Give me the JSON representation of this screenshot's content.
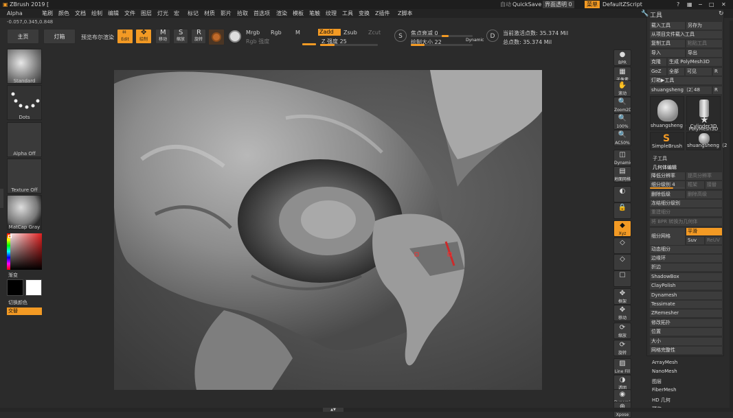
{
  "app": {
    "title": "ZBrush 2019 [",
    "autosave_label": "自动",
    "quicksave": "QuickSave",
    "ui_transparency": "界面透明 0",
    "menu_button": "菜单",
    "script": "DefaultZScript"
  },
  "menu": [
    "Alpha",
    "笔刷",
    "颜色",
    "文档",
    "绘制",
    "编辑",
    "文件",
    "图层",
    "灯光",
    "宏",
    "标记",
    "材质",
    "影片",
    "拾取",
    "首选项",
    "渲染",
    "模板",
    "笔触",
    "纹理",
    "工具",
    "变换",
    "Z插件",
    "Z脚本"
  ],
  "coords": "-0.057,0.345,0.848",
  "top": {
    "home": "主页",
    "lightbox": "灯箱",
    "preview_bpr": "预览布尔渲染",
    "edit": "Edit",
    "draw": "绘制",
    "move": "移动",
    "scale": "缩放",
    "rotate": "旋转",
    "mrgb": "Mrgb",
    "rgb": "Rgb",
    "m": "M",
    "zadd": "Zadd",
    "zsub": "Zsub",
    "zcut": "Zcut",
    "rgb_intensity": "Rgb 强度",
    "z_intensity": "Z 强度 25",
    "z_intensity_value": 25,
    "focal": "焦点衰减 0",
    "focal_value": 0,
    "draw_size": "绘制大小 22",
    "draw_size_value": 22,
    "dynamic": "Dynamic",
    "active_points": "当前激活点数: 35.374 Mil",
    "total_points": "总点数: 35.374 Mil"
  },
  "left": {
    "brush": "Standard",
    "stroke": "Dots",
    "alpha": "Alpha Off",
    "texture": "Texture Off",
    "material": "MatCap Gray",
    "gradient": "渐变",
    "switch_color": "切换颜色",
    "alternate": "交替"
  },
  "right_shelf": [
    "BPR",
    "子像素",
    "滚动",
    "Zoom2D",
    "100%",
    "AC50%",
    "Dynamic 透视",
    "地面网格",
    "",
    "",
    "Xyz",
    "",
    "",
    "",
    "框架",
    "移动",
    "缩放",
    "旋转",
    "Line Fill PolyF",
    "透明",
    "Dynamic 独显",
    "Xpose"
  ],
  "tool_panel": {
    "title": "工具",
    "load_tool": "载入工具",
    "save_as": "另存为",
    "load_from_project": "从项目文件载入工具",
    "copy_tool": "复制工具",
    "paste_tool": "粘贴工具",
    "import": "导入",
    "export": "导出",
    "clone": "克隆",
    "make_polymesh": "生成 PolyMesh3D",
    "goz": "GoZ",
    "all": "全部",
    "visible": "可见",
    "r": "R",
    "lightbox_tools": "灯箱▶工具",
    "current_tool": "shuangsheng（2）",
    "current_count": "48",
    "tools": [
      "shuangsheng（2",
      "Cylinder3D",
      "SimpleBrush",
      "PolyMesh3D",
      "shuangsheng（2"
    ],
    "subtool": "子工具",
    "geometry": "几何体编辑",
    "lower_res": "降低分辨率",
    "higher_res": "提高分辨率",
    "sdiv": "细分级别 4",
    "sdiv_value": 4,
    "sdiv_max": 6,
    "cage": "框架",
    "rstr": "接替",
    "del_lower": "删除低级",
    "del_higher": "删除高级",
    "freeze": "冻结细分级别",
    "reconstruct": "重建细分",
    "bpr_convert": "将 BPR 转换为几何体",
    "divide": "细分网格",
    "smooth": "平滑",
    "suv": "Suv",
    "reuv": "ReUV",
    "dynamic_sub": "动态细分",
    "items": [
      "边缘环",
      "折边",
      "ShadowBox",
      "ClayPolish",
      "Dynamesh",
      "Tessimate",
      "ZRemesher",
      "修改拓扑",
      "位置",
      "大小",
      "网格完整性"
    ],
    "bottom": [
      "ArrayMesh",
      "NanoMesh",
      "图层",
      "FiberMesh",
      "HD 几何",
      "预览"
    ]
  },
  "colors": {
    "accent": "#f39a24",
    "bg": "#2b2b2b",
    "panel": "#2f2f2f"
  }
}
